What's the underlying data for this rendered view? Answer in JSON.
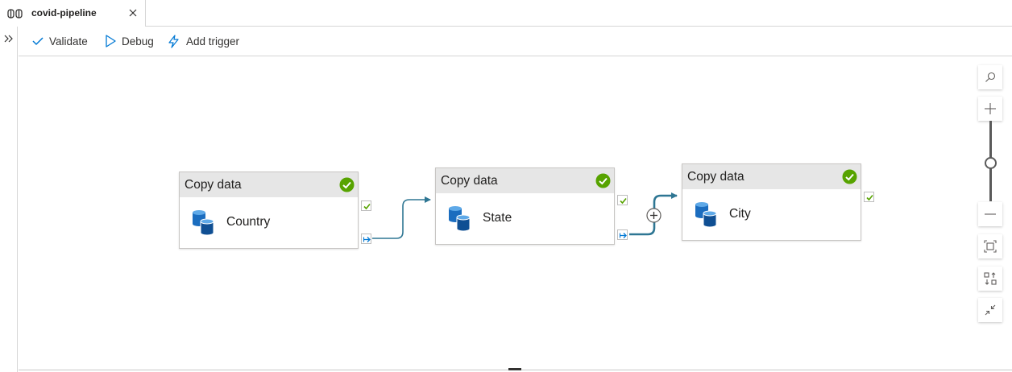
{
  "tab": {
    "title": "covid-pipeline"
  },
  "toolbar": {
    "validate_label": "Validate",
    "debug_label": "Debug",
    "add_trigger_label": "Add trigger"
  },
  "activities": [
    {
      "type": "Copy data",
      "name": "Country",
      "status": "succeeded"
    },
    {
      "type": "Copy data",
      "name": "State",
      "status": "succeeded"
    },
    {
      "type": "Copy data",
      "name": "City",
      "status": "succeeded"
    }
  ],
  "colors": {
    "accent": "#0078d4",
    "connector": "#2e7693",
    "success": "#57a300",
    "header_bg": "#e6e6e6",
    "datastore": "#1b6dbf"
  },
  "icons": {
    "tab": "pipeline-icon",
    "validate": "checkmark-icon",
    "debug": "play-icon",
    "add_trigger": "lightning-icon",
    "search": "search-icon",
    "zoom_in": "plus-icon",
    "zoom_out": "minus-icon",
    "fit": "fit-to-screen-icon",
    "auto_align": "auto-align-icon",
    "collapse": "collapse-icon"
  }
}
